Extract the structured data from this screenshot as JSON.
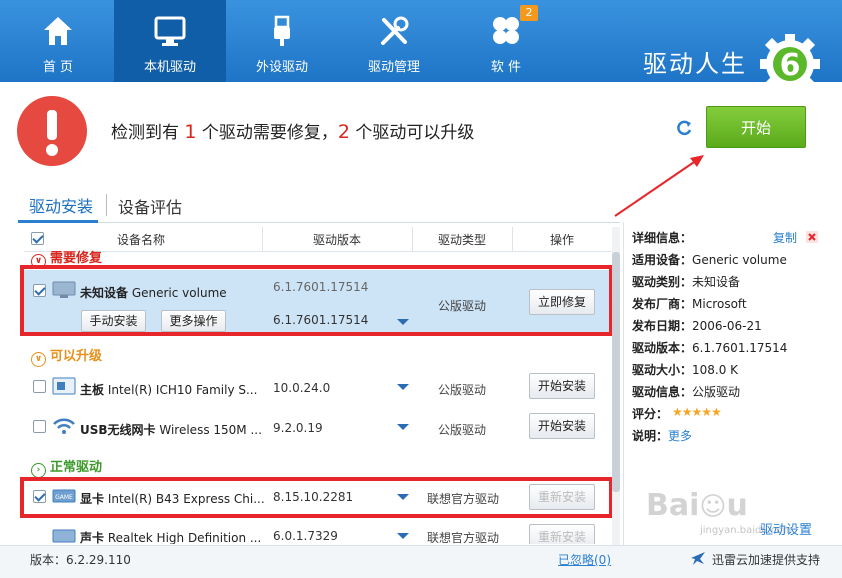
{
  "nav": {
    "tabs": [
      {
        "label": "首 页",
        "icon": "home-icon"
      },
      {
        "label": "本机驱动",
        "icon": "monitor-icon"
      },
      {
        "label": "外设驱动",
        "icon": "usb-icon"
      },
      {
        "label": "驱动管理",
        "icon": "tools-icon"
      },
      {
        "label": "软 件",
        "icon": "clover-icon",
        "badge": "2"
      }
    ],
    "active_index": 1,
    "brand": "驱动人生",
    "brand_number": "6"
  },
  "status": {
    "prefix": "检测到有 ",
    "repair_count": "1",
    "mid": " 个驱动需要修复，",
    "upgrade_count": "2",
    "suffix": " 个驱动可以升级"
  },
  "start_button": "开始",
  "tabs": {
    "install": "驱动安装",
    "evaluate": "设备评估"
  },
  "table": {
    "headers": [
      "设备名称",
      "驱动版本",
      "驱动类型",
      "操作"
    ]
  },
  "sections": {
    "repair": "需要修复",
    "upgrade": "可以升级",
    "normal": "正常驱动"
  },
  "rows": {
    "r1": {
      "category": "未知设备",
      "name": " Generic volume",
      "ver_old": "6.1.7601.17514",
      "ver_new": "6.1.7601.17514",
      "type": "公版驱动",
      "action": "立即修复",
      "manual": "手动安装",
      "more": "更多操作"
    },
    "r2": {
      "category": "主板",
      "name": " Intel(R) ICH10 Family S...",
      "ver": "10.0.24.0",
      "type": "公版驱动",
      "action": "开始安装"
    },
    "r3": {
      "category": "USB无线网卡",
      "name": " Wireless 150M ...",
      "ver": "9.2.0.19",
      "type": "公版驱动",
      "action": "开始安装"
    },
    "r4": {
      "category": "显卡",
      "name": " Intel(R) B43 Express Chi...",
      "ver": "8.15.10.2281",
      "type": "联想官方驱动",
      "action": "重新安装"
    },
    "r5": {
      "category": "声卡",
      "name": " Realtek High Definition ...",
      "ver": "6.0.1.7329",
      "type": "联想官方驱动",
      "action": "重新安装"
    }
  },
  "detail": {
    "title": "详细信息：",
    "copy": "复制",
    "items": [
      {
        "k": "适用设备：",
        "v": "Generic volume"
      },
      {
        "k": "驱动类别：",
        "v": "未知设备"
      },
      {
        "k": "发布厂商：",
        "v": "Microsoft"
      },
      {
        "k": "发布日期：",
        "v": "2006-06-21"
      },
      {
        "k": "驱动版本：",
        "v": "6.1.7601.17514"
      },
      {
        "k": "驱动大小：",
        "v": "108.0 K"
      },
      {
        "k": "驱动信息：",
        "v": "公版驱动"
      }
    ],
    "rating_label": "评分：",
    "rating": 5,
    "stars": "★★★★★",
    "desc_label": "说明：",
    "desc_more": "更多",
    "settings": "驱动设置"
  },
  "footer": {
    "version": "版本：6.2.29.110",
    "ignored": "已忽略(0)",
    "accel": "迅雷云加速提供支持"
  },
  "colors": {
    "accent": "#2b7fd0",
    "red": "#e6262b",
    "green": "#5aaa1c",
    "orange": "#f39a1e"
  }
}
